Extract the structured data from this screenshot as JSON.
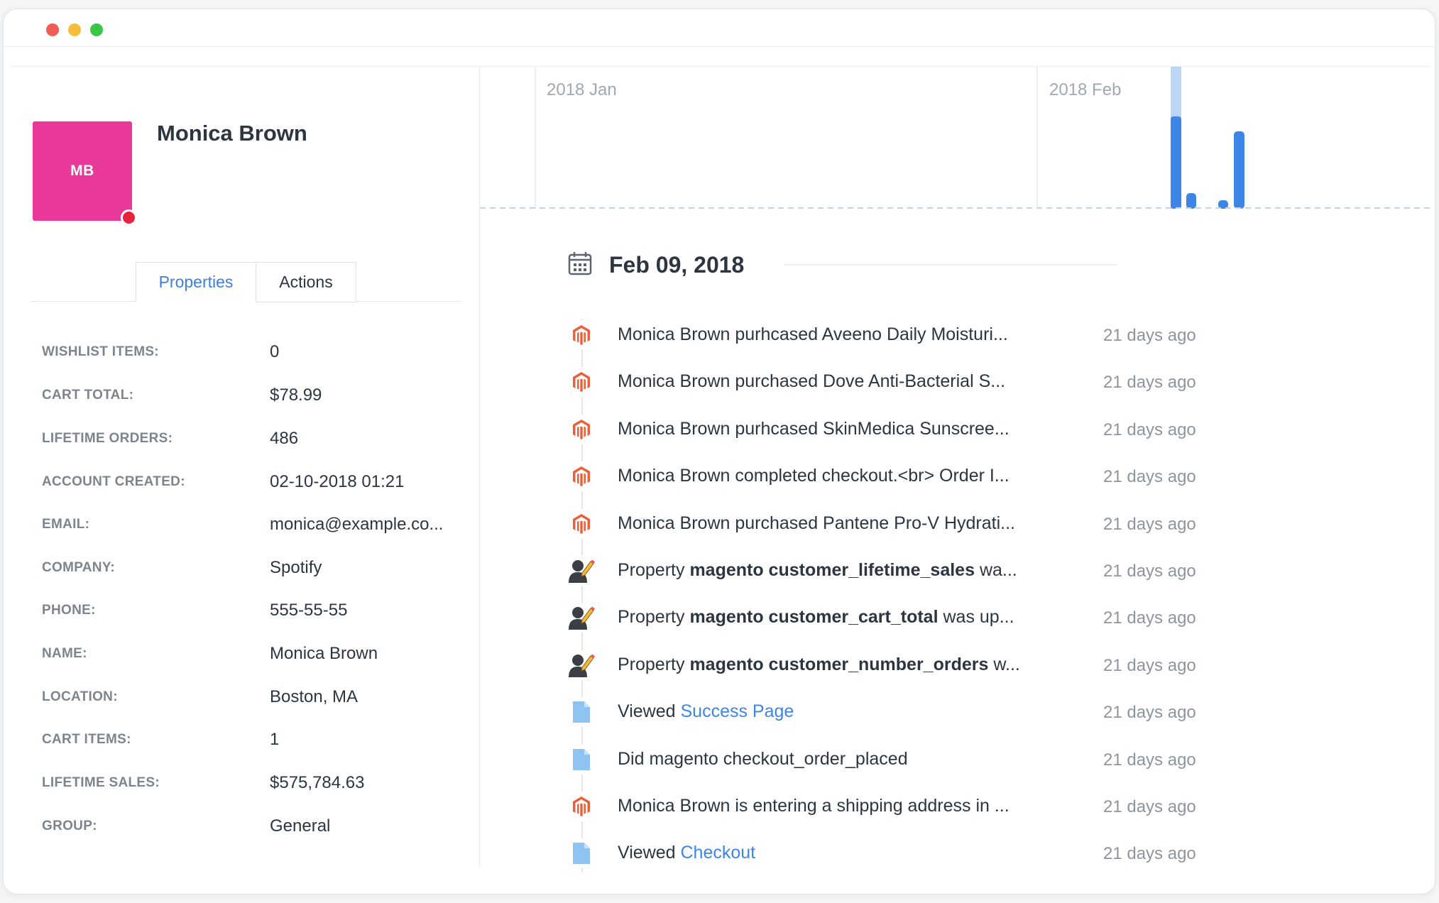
{
  "profile": {
    "initials": "MB",
    "name": "Monica Brown",
    "avatar_color": "#e8399a",
    "status_color": "#e8233e"
  },
  "tabs": [
    {
      "label": "Properties",
      "active": true
    },
    {
      "label": "Actions",
      "active": false
    }
  ],
  "properties": [
    {
      "label": "WISHLIST ITEMS:",
      "value": "0"
    },
    {
      "label": "CART TOTAL:",
      "value": "$78.99"
    },
    {
      "label": "LIFETIME ORDERS:",
      "value": "486"
    },
    {
      "label": "ACCOUNT CREATED:",
      "value": "02-10-2018 01:21"
    },
    {
      "label": "EMAIL:",
      "value": "monica@example.co..."
    },
    {
      "label": "COMPANY:",
      "value": "Spotify"
    },
    {
      "label": "PHONE:",
      "value": "555-55-55"
    },
    {
      "label": "NAME:",
      "value": "Monica Brown"
    },
    {
      "label": "LOCATION:",
      "value": "Boston, MA"
    },
    {
      "label": "CART ITEMS:",
      "value": "1"
    },
    {
      "label": "LIFETIME SALES:",
      "value": "$575,784.63"
    },
    {
      "label": "GROUP:",
      "value": "General"
    }
  ],
  "timeline": {
    "month_labels": [
      "2018 Jan",
      "2018 Feb"
    ],
    "bar_color": "#3d85e6",
    "highlight_color": "#bcd6f5"
  },
  "feed": {
    "date": "Feb 09, 2018",
    "events": [
      {
        "icon": "magento-icon",
        "prefix": "Monica Brown purhcased Aveeno Daily Moisturi...",
        "bold": "",
        "suffix": "",
        "link": "",
        "time": "21 days ago"
      },
      {
        "icon": "magento-icon",
        "prefix": "Monica Brown purchased Dove Anti-Bacterial S...",
        "bold": "",
        "suffix": "",
        "link": "",
        "time": "21 days ago"
      },
      {
        "icon": "magento-icon",
        "prefix": "Monica Brown purhcased SkinMedica Sunscree...",
        "bold": "",
        "suffix": "",
        "link": "",
        "time": "21 days ago"
      },
      {
        "icon": "magento-icon",
        "prefix": "Monica Brown completed checkout.<br> Order I...",
        "bold": "",
        "suffix": "",
        "link": "",
        "time": "21 days ago"
      },
      {
        "icon": "magento-icon",
        "prefix": "Monica Brown purchased Pantene Pro-V Hydrati...",
        "bold": "",
        "suffix": "",
        "link": "",
        "time": "21 days ago"
      },
      {
        "icon": "user-edit-icon",
        "prefix": "Property ",
        "bold": "magento customer_lifetime_sales",
        "suffix": " wa...",
        "link": "",
        "time": "21 days ago"
      },
      {
        "icon": "user-edit-icon",
        "prefix": "Property ",
        "bold": "magento customer_cart_total",
        "suffix": " was up...",
        "link": "",
        "time": "21 days ago"
      },
      {
        "icon": "user-edit-icon",
        "prefix": "Property ",
        "bold": "magento customer_number_orders",
        "suffix": " w...",
        "link": "",
        "time": "21 days ago"
      },
      {
        "icon": "page-icon",
        "prefix": "Viewed ",
        "bold": "",
        "suffix": "",
        "link": "Success Page",
        "time": "21 days ago"
      },
      {
        "icon": "page-icon",
        "prefix": "Did magento checkout_order_placed",
        "bold": "",
        "suffix": "",
        "link": "",
        "time": "21 days ago"
      },
      {
        "icon": "magento-icon",
        "prefix": "Monica Brown is entering a shipping address in ...",
        "bold": "",
        "suffix": "",
        "link": "",
        "time": "21 days ago"
      },
      {
        "icon": "page-icon",
        "prefix": "Viewed ",
        "bold": "",
        "suffix": "",
        "link": "Checkout",
        "time": "21 days ago"
      }
    ]
  }
}
